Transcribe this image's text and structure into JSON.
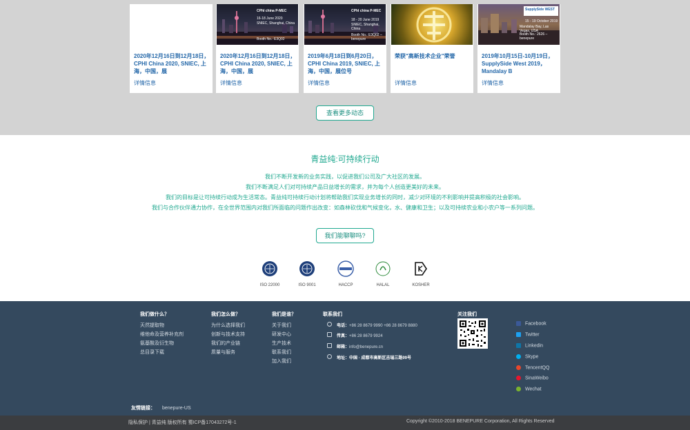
{
  "news": {
    "cards": [
      {
        "title": "2020年12月16日到12月18日，CPHI China 2020, SNIEC, 上海，中国，展",
        "more": "详情信息"
      },
      {
        "title": "2020年12月16日到12月18日，CPHI China 2020, SNIEC, 上海，中国，展",
        "more": "详情信息",
        "thumb_text": [
          "CPhI china  P-MEC",
          "16-18 June 2020",
          "SNIEC, Shanghai, China",
          "Booth No.: E3Q02"
        ]
      },
      {
        "title": "2019年6月18日到6月20日，CPHI China 2019, SNIEC, 上海，中国，展位号",
        "more": "详情信息",
        "thumb_text": [
          "CPhI china  P-MEC",
          "18 - 20 June 2019",
          "SNIEC, Shanghai, China",
          "Booth No.: E3Q02 – benepure"
        ]
      },
      {
        "title": "荣获\"高新技术企业\"荣誉",
        "more": "详情信息"
      },
      {
        "title": "2019年10月15日-10月19日，SupplySide West 2019，Mandalay B",
        "more": "详情信息",
        "thumb_text": [
          "SupplySide WEST",
          "15 - 19 October 2019",
          "Mandalay Bay, Las Vegas, USA",
          "Booth No.: 2626 – benepure"
        ]
      }
    ],
    "more_button": "查看更多动态"
  },
  "sustainability": {
    "title": "青益纯:可持续行动",
    "lines": [
      "我们不断开发新的业务实践，以促进我们公司及广大社区的发展。",
      "我们不断满足人们对可持续产品日益增长的需求，并为每个人创造更美好的未来。",
      "我们的目标是让可持续行动成为生活常态。青益纯可持续行动计划将帮助我们实现业务增长的同时，减少对环境的不利影响并提高积极的社会影响。",
      "我们与合作伙伴通力协作，在全世界范围内对我们所面临的问题作出改变：如森林砍伐和气候变化，水、健康和卫生；以及可持续农业和小农户等一系列问题。"
    ],
    "button": "我们能聊聊吗?"
  },
  "certs": [
    "ISO 22000",
    "ISO 9001",
    "HACCP",
    "HALAL",
    "KOSHER"
  ],
  "footer": {
    "col1": {
      "head": "我们做什么？",
      "links": [
        "天然提取物",
        "维他命及营养补充剂",
        "氨基酸及衍生物",
        "总目录下载"
      ]
    },
    "col2": {
      "head": "我们怎么做？",
      "links": [
        "为什么选择我们",
        "创新与技术支持",
        "我们的产业链",
        "质量与服务"
      ]
    },
    "col3": {
      "head": "我们是谁？",
      "links": [
        "关于我们",
        "研发中心",
        "生产技术",
        "联系我们",
        "加入我们"
      ]
    },
    "contact": {
      "head": "联系我们",
      "phone_label": "电话：",
      "phone": "+86 28 8679 9990 +86 28 8679 8880",
      "fax_label": "传真：",
      "fax": "+86 28 8679 9924",
      "email_label": "邮箱：",
      "email": "info@benepure.cn",
      "addr_label": "地址：",
      "addr": "中国 · 成都市高新区吉瑞三路99号"
    },
    "follow": {
      "head": "关注我们"
    },
    "social": [
      {
        "name": "Facebook",
        "color": "#3b5998"
      },
      {
        "name": "Twitter",
        "color": "#1da1f2"
      },
      {
        "name": "Linkedin",
        "color": "#0e76a8"
      },
      {
        "name": "Skype",
        "color": "#00aff0"
      },
      {
        "name": "TencentQQ",
        "color": "#e8472c"
      },
      {
        "name": "SinaWeibo",
        "color": "#e6162d"
      },
      {
        "name": "Wechat",
        "color": "#7bb32e"
      }
    ],
    "friend_label": "友情链接：",
    "friend_link": "benepure-US",
    "bottom_left": "隐私保护 | 青益纯 版权所有 蜀ICP备17043272号-1",
    "bottom_right": "Copyright ©2010-2018 BENEPURE Corporation, All Rights Reserved"
  }
}
